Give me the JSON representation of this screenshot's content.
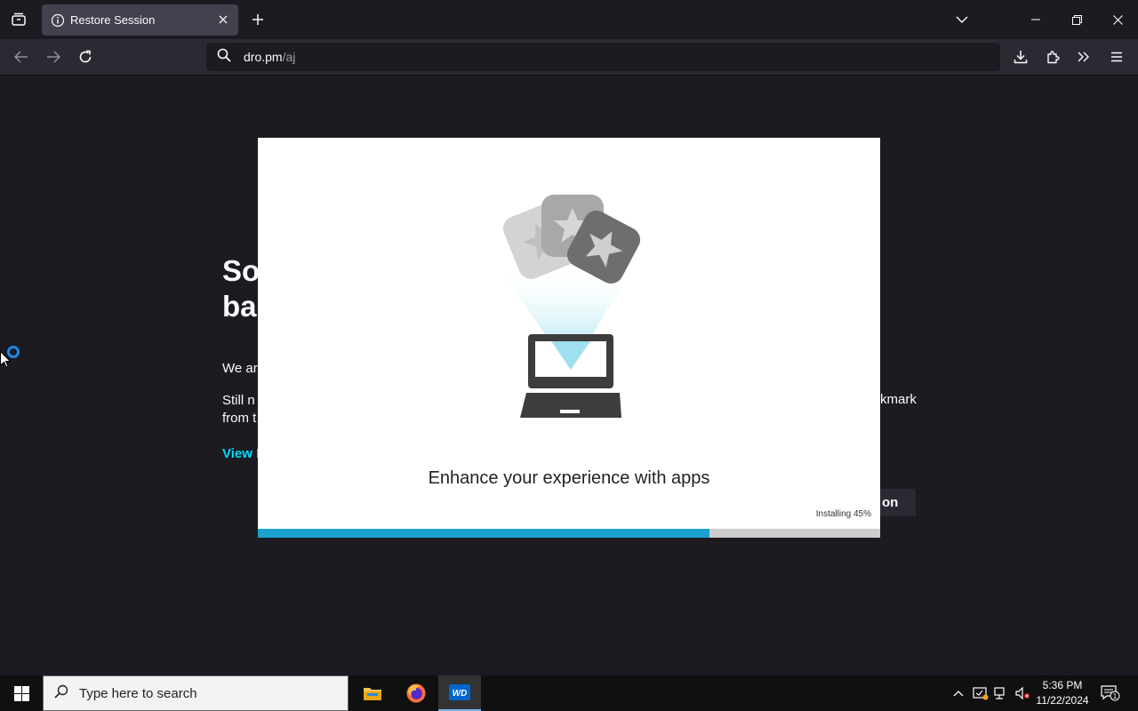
{
  "browser": {
    "tab_title": "Restore Session",
    "url_host": "dro.pm",
    "url_path": "/aj"
  },
  "background_page": {
    "heading_line1": "So",
    "heading_line2": "ba",
    "para1": "We ar",
    "para2_line1": "Still n",
    "para2_line2": "from t",
    "link": "View I",
    "right_fragment": "kmark",
    "button_fragment": "on"
  },
  "dialog": {
    "title": "Enhance your experience with apps",
    "status": "Installing 45%",
    "progress_fraction": 0.725
  },
  "taskbar": {
    "search_placeholder": "Type here to search",
    "time": "5:36 PM",
    "date": "11/22/2024",
    "notification_count": "1",
    "wd_label": "WD"
  },
  "colors": {
    "accent_cyan": "#00ddff",
    "progress": "#1ba1d0"
  }
}
